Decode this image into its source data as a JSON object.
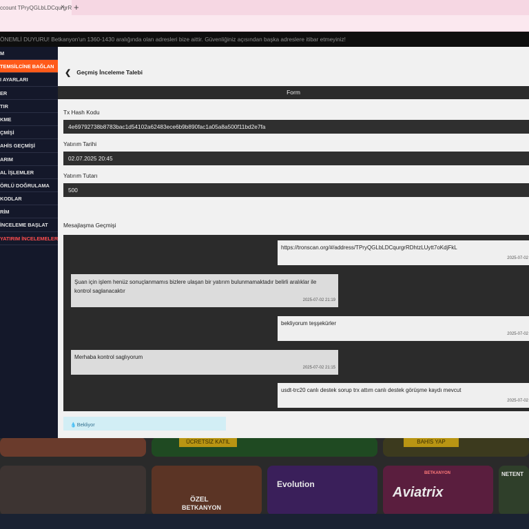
{
  "browser": {
    "tab_title": "ccount TPryQGLbLDCqurgrR",
    "tab_close": "×",
    "new_tab": "+"
  },
  "announcement": "ÖNEMLİ DUYURU! Betkanyon'un 1360-1430 aralığında olan adresleri bize aittir. Güvenliğiniz açısından başka adreslere itibar etmeyiniz!",
  "sidebar": {
    "items": [
      {
        "label": "M"
      },
      {
        "label": "TEMSİLCİNE BAĞLAN"
      },
      {
        "label": "I AYARLARI"
      },
      {
        "label": "ER"
      },
      {
        "label": "TIR"
      },
      {
        "label": "KME"
      },
      {
        "label": "ÇMİŞİ"
      },
      {
        "label": "AHİS GEÇMİŞİ"
      },
      {
        "label": "ARIM"
      },
      {
        "label": "AL İŞLEMLER"
      },
      {
        "label": "ÖRLÜ DOĞRULAMA"
      },
      {
        "label": "KODLAR"
      },
      {
        "label": "RİM"
      },
      {
        "label": "İNCELEME BAŞLAT"
      },
      {
        "label": "YATIRIM İNCELEMELERİ"
      }
    ]
  },
  "panel": {
    "back_title": "Geçmiş İnceleme Talebi",
    "form_header": "Form",
    "tx_hash_label": "Tx Hash Kodu",
    "tx_hash_value": "4e69792738b8783bac1d54102a62483ece6b9b890fac1a05a8a500f11bd2e7fa",
    "deposit_date_label": "Yatırım Tarihi",
    "deposit_date_value": "02.07.2025 20:45",
    "deposit_amount_label": "Yatırım Tutarı",
    "deposit_amount_value": "500",
    "chat_label": "Mesajlaşma Geçmişi",
    "messages": [
      {
        "text": "https://tronscan.org/#/address/TPryQGLbLDCqurgrRDhtzLUytt7oKdjFkL",
        "time": "2025-07-02"
      },
      {
        "text": "Şuan için işlem henüz sonuçlanmamıs bizlere ulaşan bir yatırım bulunmamaktadır belirli aralıklar ile kontrol saglanacaktır",
        "time": "2025-07-02 21:19"
      },
      {
        "text": "bekliyorum teşşekürler",
        "time": "2025-07-02"
      },
      {
        "text": "Merhaba kontrol saglıyorum",
        "time": "2025-07-02 21:15"
      },
      {
        "text": "usdt-trc20 canlı destek sorup trx attım canlı destek görüşme kaydı mevcut",
        "time": "2025-07-02"
      }
    ],
    "status": "Bekliyor"
  },
  "background": {
    "promo_buttons": [
      "ÜCRETSİZ KATIL",
      "BAHİS YAP"
    ],
    "game_titles": [
      "ÖZEL",
      "BETKANYON",
      "Evolution",
      "BETKANYON",
      "Aviatrix",
      "NETENT"
    ]
  },
  "colors": {
    "accent": "#ff5a1a",
    "sidebar_bg": "#14182a",
    "panel_bg": "#f1f1f1",
    "field_bg": "#2f2f2f",
    "status_bg": "#d2eef5"
  }
}
